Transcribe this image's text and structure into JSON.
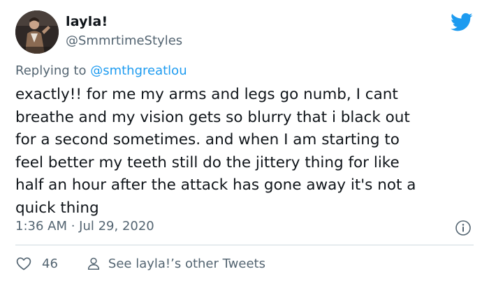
{
  "author": {
    "display_name": "layla!",
    "handle": "@SmmrtimeStyles"
  },
  "reply": {
    "prefix": "Replying to ",
    "mention": "@smthgreatlou"
  },
  "tweet": {
    "text": "exactly!! for me my arms and legs go numb, I cant\nbreathe and my vision gets so blurry that i black out\nfor a second sometimes. and when I am starting to\nfeel better my teeth still do the jittery thing for like\nhalf an hour after the attack has gone away it's not a\nquick thing",
    "timestamp": "1:36 AM · Jul 29, 2020"
  },
  "actions": {
    "like_count": "46",
    "profile_link": "See layla!’s other Tweets"
  },
  "icons": {
    "logo": "twitter-bird-icon",
    "info": "info-icon",
    "like": "heart-icon",
    "profile": "user-icon"
  },
  "colors": {
    "brand": "#1d9bf0",
    "text": "#0f1419",
    "secondary": "#536471",
    "divider": "#cfd9de"
  }
}
